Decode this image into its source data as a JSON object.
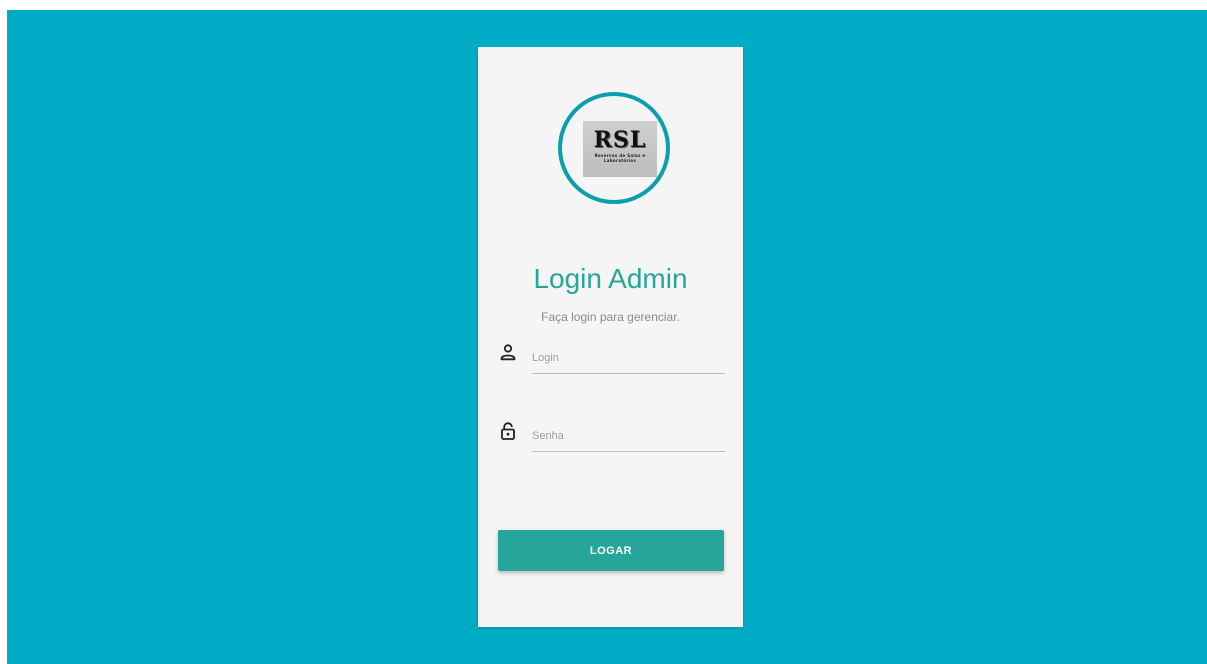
{
  "theme": {
    "background": "#00acc5",
    "card": "#f5f5f5",
    "accent": "#26a69a",
    "ring": "#0b9fae"
  },
  "logo": {
    "mark": "RSL",
    "tagline": "Reservas de Salas e Laboratórios"
  },
  "login": {
    "title": "Login Admin",
    "subtitle": "Faça login para gerenciar.",
    "username": {
      "icon": "person-icon",
      "placeholder": "Login",
      "value": ""
    },
    "password": {
      "icon": "lock-icon",
      "placeholder": "Senha",
      "value": ""
    },
    "submit_label": "LOGAR"
  }
}
